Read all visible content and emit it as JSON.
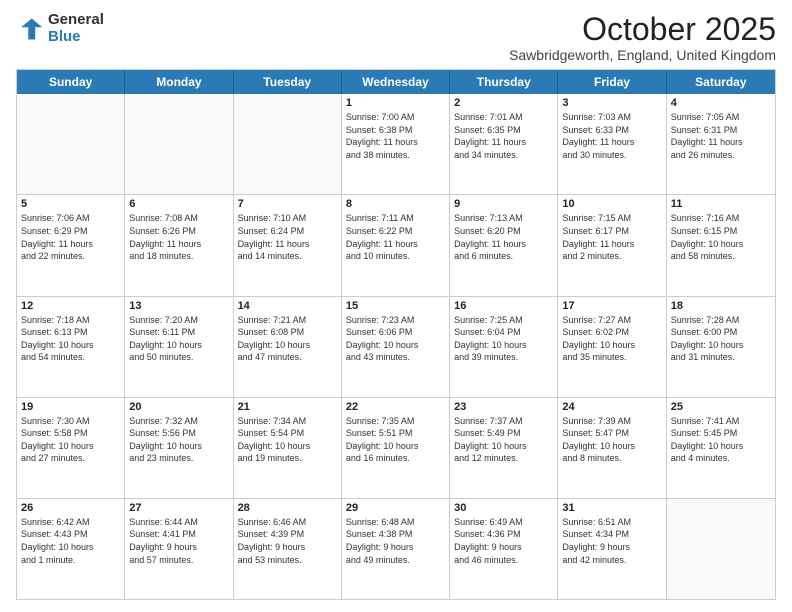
{
  "logo": {
    "general": "General",
    "blue": "Blue"
  },
  "title": "October 2025",
  "location": "Sawbridgeworth, England, United Kingdom",
  "headers": [
    "Sunday",
    "Monday",
    "Tuesday",
    "Wednesday",
    "Thursday",
    "Friday",
    "Saturday"
  ],
  "rows": [
    [
      {
        "day": "",
        "info": ""
      },
      {
        "day": "",
        "info": ""
      },
      {
        "day": "",
        "info": ""
      },
      {
        "day": "1",
        "info": "Sunrise: 7:00 AM\nSunset: 6:38 PM\nDaylight: 11 hours\nand 38 minutes."
      },
      {
        "day": "2",
        "info": "Sunrise: 7:01 AM\nSunset: 6:35 PM\nDaylight: 11 hours\nand 34 minutes."
      },
      {
        "day": "3",
        "info": "Sunrise: 7:03 AM\nSunset: 6:33 PM\nDaylight: 11 hours\nand 30 minutes."
      },
      {
        "day": "4",
        "info": "Sunrise: 7:05 AM\nSunset: 6:31 PM\nDaylight: 11 hours\nand 26 minutes."
      }
    ],
    [
      {
        "day": "5",
        "info": "Sunrise: 7:06 AM\nSunset: 6:29 PM\nDaylight: 11 hours\nand 22 minutes."
      },
      {
        "day": "6",
        "info": "Sunrise: 7:08 AM\nSunset: 6:26 PM\nDaylight: 11 hours\nand 18 minutes."
      },
      {
        "day": "7",
        "info": "Sunrise: 7:10 AM\nSunset: 6:24 PM\nDaylight: 11 hours\nand 14 minutes."
      },
      {
        "day": "8",
        "info": "Sunrise: 7:11 AM\nSunset: 6:22 PM\nDaylight: 11 hours\nand 10 minutes."
      },
      {
        "day": "9",
        "info": "Sunrise: 7:13 AM\nSunset: 6:20 PM\nDaylight: 11 hours\nand 6 minutes."
      },
      {
        "day": "10",
        "info": "Sunrise: 7:15 AM\nSunset: 6:17 PM\nDaylight: 11 hours\nand 2 minutes."
      },
      {
        "day": "11",
        "info": "Sunrise: 7:16 AM\nSunset: 6:15 PM\nDaylight: 10 hours\nand 58 minutes."
      }
    ],
    [
      {
        "day": "12",
        "info": "Sunrise: 7:18 AM\nSunset: 6:13 PM\nDaylight: 10 hours\nand 54 minutes."
      },
      {
        "day": "13",
        "info": "Sunrise: 7:20 AM\nSunset: 6:11 PM\nDaylight: 10 hours\nand 50 minutes."
      },
      {
        "day": "14",
        "info": "Sunrise: 7:21 AM\nSunset: 6:08 PM\nDaylight: 10 hours\nand 47 minutes."
      },
      {
        "day": "15",
        "info": "Sunrise: 7:23 AM\nSunset: 6:06 PM\nDaylight: 10 hours\nand 43 minutes."
      },
      {
        "day": "16",
        "info": "Sunrise: 7:25 AM\nSunset: 6:04 PM\nDaylight: 10 hours\nand 39 minutes."
      },
      {
        "day": "17",
        "info": "Sunrise: 7:27 AM\nSunset: 6:02 PM\nDaylight: 10 hours\nand 35 minutes."
      },
      {
        "day": "18",
        "info": "Sunrise: 7:28 AM\nSunset: 6:00 PM\nDaylight: 10 hours\nand 31 minutes."
      }
    ],
    [
      {
        "day": "19",
        "info": "Sunrise: 7:30 AM\nSunset: 5:58 PM\nDaylight: 10 hours\nand 27 minutes."
      },
      {
        "day": "20",
        "info": "Sunrise: 7:32 AM\nSunset: 5:56 PM\nDaylight: 10 hours\nand 23 minutes."
      },
      {
        "day": "21",
        "info": "Sunrise: 7:34 AM\nSunset: 5:54 PM\nDaylight: 10 hours\nand 19 minutes."
      },
      {
        "day": "22",
        "info": "Sunrise: 7:35 AM\nSunset: 5:51 PM\nDaylight: 10 hours\nand 16 minutes."
      },
      {
        "day": "23",
        "info": "Sunrise: 7:37 AM\nSunset: 5:49 PM\nDaylight: 10 hours\nand 12 minutes."
      },
      {
        "day": "24",
        "info": "Sunrise: 7:39 AM\nSunset: 5:47 PM\nDaylight: 10 hours\nand 8 minutes."
      },
      {
        "day": "25",
        "info": "Sunrise: 7:41 AM\nSunset: 5:45 PM\nDaylight: 10 hours\nand 4 minutes."
      }
    ],
    [
      {
        "day": "26",
        "info": "Sunrise: 6:42 AM\nSunset: 4:43 PM\nDaylight: 10 hours\nand 1 minute."
      },
      {
        "day": "27",
        "info": "Sunrise: 6:44 AM\nSunset: 4:41 PM\nDaylight: 9 hours\nand 57 minutes."
      },
      {
        "day": "28",
        "info": "Sunrise: 6:46 AM\nSunset: 4:39 PM\nDaylight: 9 hours\nand 53 minutes."
      },
      {
        "day": "29",
        "info": "Sunrise: 6:48 AM\nSunset: 4:38 PM\nDaylight: 9 hours\nand 49 minutes."
      },
      {
        "day": "30",
        "info": "Sunrise: 6:49 AM\nSunset: 4:36 PM\nDaylight: 9 hours\nand 46 minutes."
      },
      {
        "day": "31",
        "info": "Sunrise: 6:51 AM\nSunset: 4:34 PM\nDaylight: 9 hours\nand 42 minutes."
      },
      {
        "day": "",
        "info": ""
      }
    ]
  ]
}
